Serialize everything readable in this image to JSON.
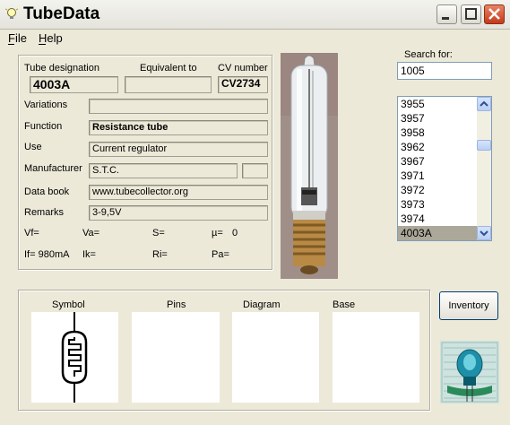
{
  "window": {
    "title": "TubeData"
  },
  "menu": {
    "file_label": "File",
    "help_label": "Help"
  },
  "details": {
    "tube_designation_label": "Tube designation",
    "tube_designation_value": "4003A",
    "equivalent_label": "Equivalent to",
    "equivalent_value": "",
    "cv_label": "CV number",
    "cv_value": "CV2734",
    "variations_label": "Variations",
    "variations_value": "",
    "function_label": "Function",
    "function_value": "Resistance tube",
    "use_label": "Use",
    "use_value": "Current regulator",
    "manufacturer_label": "Manufacturer",
    "manufacturer_value": "S.T.C.",
    "manufacturer_extra": "",
    "databook_label": "Data book",
    "databook_value": "www.tubecollector.org",
    "remarks_label": "Remarks",
    "remarks_value": "3-9,5V",
    "params": {
      "vf": "Vf=",
      "va": "Va=",
      "s": "S=",
      "mu": "µ=",
      "mu_value": "0",
      "if": "If= 980mA",
      "ik": "Ik=",
      "ri": "Ri=",
      "pa": "Pa="
    }
  },
  "search": {
    "label": "Search for:",
    "value": "1005",
    "list": [
      "3955",
      "3957",
      "3958",
      "3962",
      "3967",
      "3971",
      "3972",
      "3973",
      "3974",
      "4003A"
    ],
    "selected": "4003A"
  },
  "bottom": {
    "symbol_label": "Symbol",
    "pins_label": "Pins",
    "diagram_label": "Diagram",
    "base_label": "Base",
    "inventory_label": "Inventory"
  }
}
